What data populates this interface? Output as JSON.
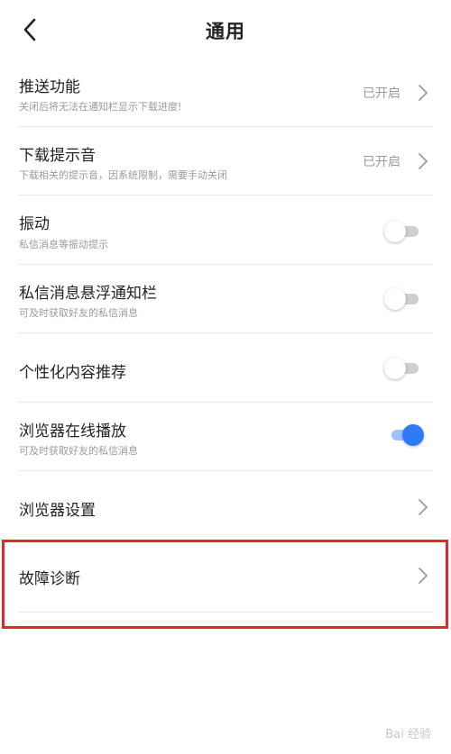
{
  "header": {
    "title": "通用",
    "back_icon": "chevron-left-icon"
  },
  "items": [
    {
      "title": "推送功能",
      "subtitle": "关闭后将无法在通知栏显示下载进度!",
      "status": "已开启",
      "control": "chevron"
    },
    {
      "title": "下载提示音",
      "subtitle": "下载相关的提示音，因系统限制，需要手动关闭",
      "status": "已开启",
      "control": "chevron"
    },
    {
      "title": "振动",
      "subtitle": "私信消息等振动提示",
      "control": "toggle",
      "on": false
    },
    {
      "title": "私信消息悬浮通知栏",
      "subtitle": "可及时获取好友的私信消息",
      "control": "toggle",
      "on": false
    },
    {
      "title": "个性化内容推荐",
      "control": "toggle",
      "on": false
    },
    {
      "title": "浏览器在线播放",
      "subtitle": "可及时获取好友的私信消息",
      "control": "toggle",
      "on": true
    },
    {
      "title": "浏览器设置",
      "control": "chevron"
    },
    {
      "title": "故障诊断",
      "control": "chevron"
    }
  ],
  "watermark": "Bai 经验",
  "colors": {
    "highlight": "#e0282e",
    "toggle_on": "#2f7bf5",
    "toggle_off": "#cfcfcf"
  }
}
